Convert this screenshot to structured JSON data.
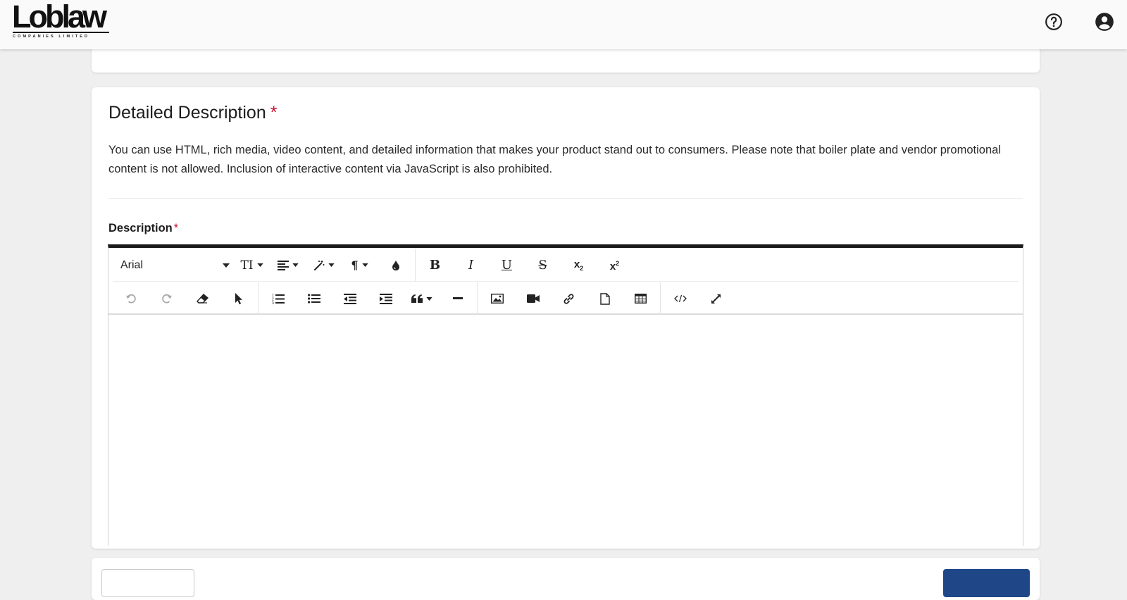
{
  "header": {
    "logo_text": "Loblaw",
    "logo_subtext": "COMPANIES LIMITED",
    "help_icon": "help-circle-icon",
    "account_icon": "account-circle-icon"
  },
  "section": {
    "title": "Detailed Description",
    "required_marker": "*",
    "description": "You can use HTML, rich media, video content, and detailed information that makes your product stand out to consumers. Please note that boiler plate and vendor promotional content is not allowed. Inclusion of interactive content via JavaScript is also prohibited."
  },
  "field": {
    "label": "Description",
    "required_marker": "*",
    "value": ""
  },
  "editor": {
    "font_family": "Arial",
    "toolbar_row1": [
      "font-size-icon",
      "align-icon",
      "magic-wand-icon",
      "paragraph-icon",
      "text-color-icon",
      "bold-icon",
      "italic-icon",
      "underline-icon",
      "strikethrough-icon",
      "subscript-icon",
      "superscript-icon"
    ],
    "toolbar_row2": [
      "undo-icon",
      "redo-icon",
      "eraser-icon",
      "select-cursor-icon",
      "ordered-list-icon",
      "unordered-list-icon",
      "outdent-icon",
      "indent-icon",
      "quote-icon",
      "horizontal-rule-icon",
      "image-icon",
      "video-icon",
      "link-icon",
      "file-icon",
      "table-icon",
      "code-view-icon",
      "fullscreen-icon"
    ],
    "glyphs": {
      "font_size": "TI",
      "paragraph": "¶",
      "bold": "B",
      "italic": "I",
      "underline": "U",
      "strike": "S",
      "sub_base": "x",
      "sub_mark": "2",
      "sup_base": "x",
      "sup_mark": "2"
    }
  },
  "colors": {
    "accent": "#1f4788",
    "required": "#c8102e",
    "header_bg": "#fafafa",
    "page_bg": "#efefef"
  }
}
